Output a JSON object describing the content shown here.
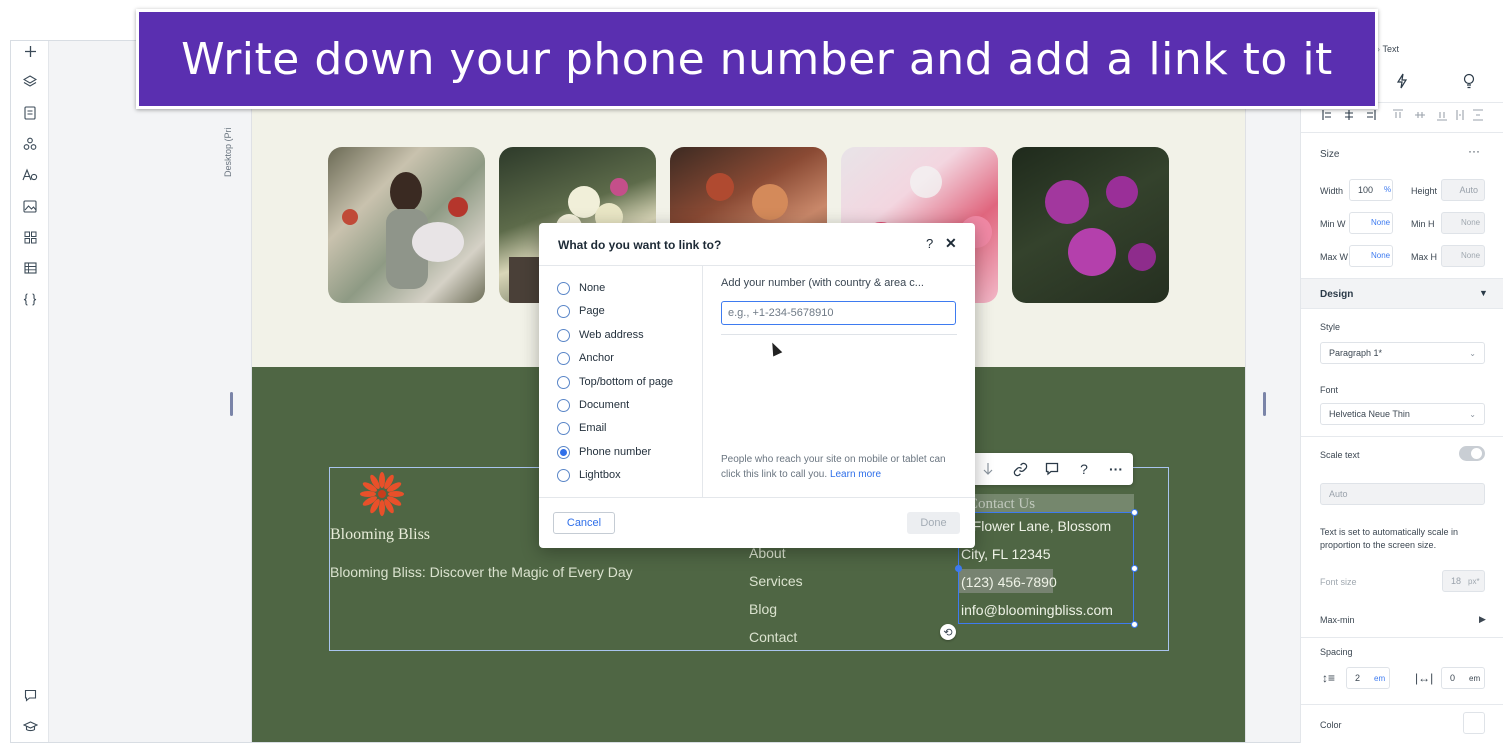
{
  "banner": {
    "text": "Write down your phone number and add a link to it"
  },
  "canvas": {
    "view_label": "Desktop (Pri"
  },
  "left_rail": {
    "icons": [
      "add-icon",
      "layers-icon",
      "pages-icon",
      "apps-icon",
      "text-theme-icon",
      "media-icon",
      "add-apps-icon",
      "table-icon",
      "code-icon",
      "comments-icon",
      "learn-icon"
    ]
  },
  "site": {
    "footer": {
      "brand": "Blooming Bliss",
      "tagline": "Blooming Bliss: Discover the Magic of Every Day",
      "nav": [
        "About",
        "Services",
        "Blog",
        "Contact"
      ],
      "contact_heading": "Contact Us",
      "contact_lines": [
        "3 Flower Lane, Blossom",
        "City, FL 12345",
        "(123) 456-7890",
        "info@bloomingbliss.com"
      ]
    }
  },
  "link_dialog": {
    "title": "What do you want to link to?",
    "help": "?",
    "close": "✕",
    "options": [
      "None",
      "Page",
      "Web address",
      "Anchor",
      "Top/bottom of page",
      "Document",
      "Email",
      "Phone number",
      "Lightbox"
    ],
    "selected": "Phone number",
    "number_label": "Add your number (with country & area c...",
    "number_value": "",
    "number_placeholder": "e.g., +1-234-5678910",
    "hint": "People who reach your site on mobile or tablet can click this link to call you.",
    "learn_more": "Learn more",
    "cancel": "Cancel",
    "done": "Done"
  },
  "float_toolbar": {
    "help": "?",
    "more": "···"
  },
  "inspector": {
    "breadcrumb": "Text",
    "size_label": "Size",
    "width_label": "Width",
    "width_value": "100",
    "width_unit": "%",
    "height_label": "Height",
    "height_value": "Auto",
    "minw_label": "Min W",
    "minw_value": "None",
    "minh_label": "Min H",
    "minh_value": "None",
    "maxw_label": "Max W",
    "maxw_value": "None",
    "maxh_label": "Max H",
    "maxh_value": "None",
    "design_label": "Design",
    "style_label": "Style",
    "style_value": "Paragraph 1*",
    "font_label": "Font",
    "font_value": "Helvetica Neue Thin",
    "scale_label": "Scale text",
    "scale_select": "Auto",
    "scale_note": "Text is set to automatically scale in proportion to the screen size.",
    "font_size_label": "Font size",
    "font_size_value": "18",
    "font_size_unit": "px*",
    "maxmin_label": "Max-min",
    "spacing_label": "Spacing",
    "line_spacing": "2",
    "line_unit": "em",
    "letter_spacing": "0",
    "letter_unit": "em",
    "color_label": "Color"
  },
  "colors": {
    "accent": "#3e7bf0",
    "banner": "#5a2fb0",
    "footer": "#4f6644",
    "page_bg": "#f2f2e8"
  }
}
